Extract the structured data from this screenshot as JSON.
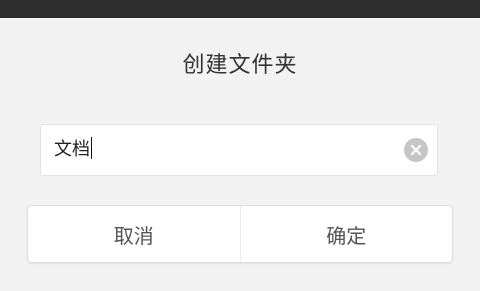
{
  "dialog": {
    "title": "创建文件夹",
    "input_value": "文档",
    "clear_icon": "clear-circle-icon",
    "cancel_label": "取消",
    "confirm_label": "确定"
  },
  "colors": {
    "background": "#f2f2f2",
    "status_strip": "#2d2d2d",
    "clear_icon_bg": "#c6c6c6"
  }
}
